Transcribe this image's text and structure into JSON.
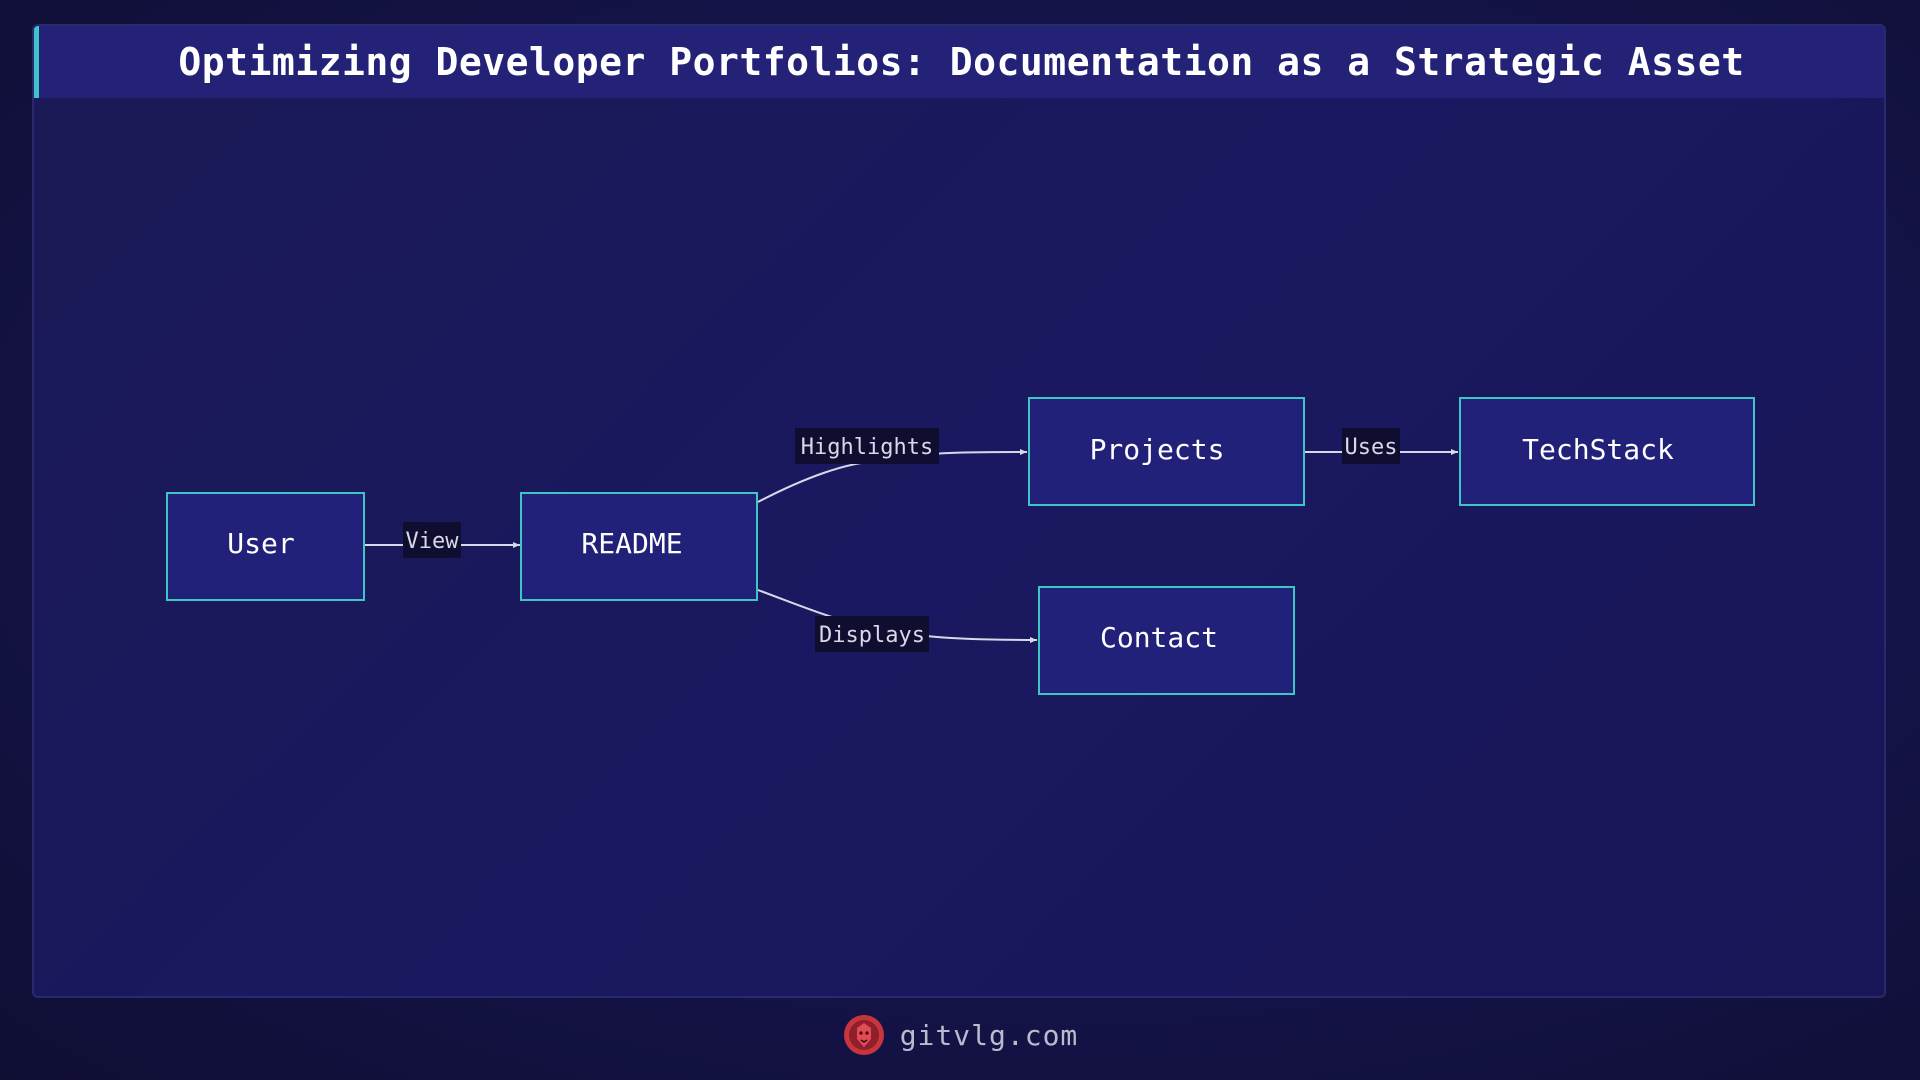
{
  "title": "Optimizing Developer Portfolios: Documentation as a Strategic Asset",
  "diagram": {
    "nodes": {
      "user": "User",
      "readme": "README",
      "projects": "Projects",
      "techstack": "TechStack",
      "contact": "Contact"
    },
    "edges": {
      "view": "View",
      "highlights": "Highlights",
      "displays": "Displays",
      "uses": "Uses"
    }
  },
  "footer": {
    "site": "gitvlg.com",
    "logo_icon": "lion-head-icon"
  },
  "colors": {
    "background": "#12113a",
    "panel": "#1b1a55",
    "title_bar": "#232277",
    "accent": "#3ec6c6",
    "node_fill": "#22217a",
    "node_border": "#3ec6c6",
    "edge": "#d8d8e8",
    "edge_label_bg": "#0f0e30",
    "logo": "#c8353d"
  }
}
